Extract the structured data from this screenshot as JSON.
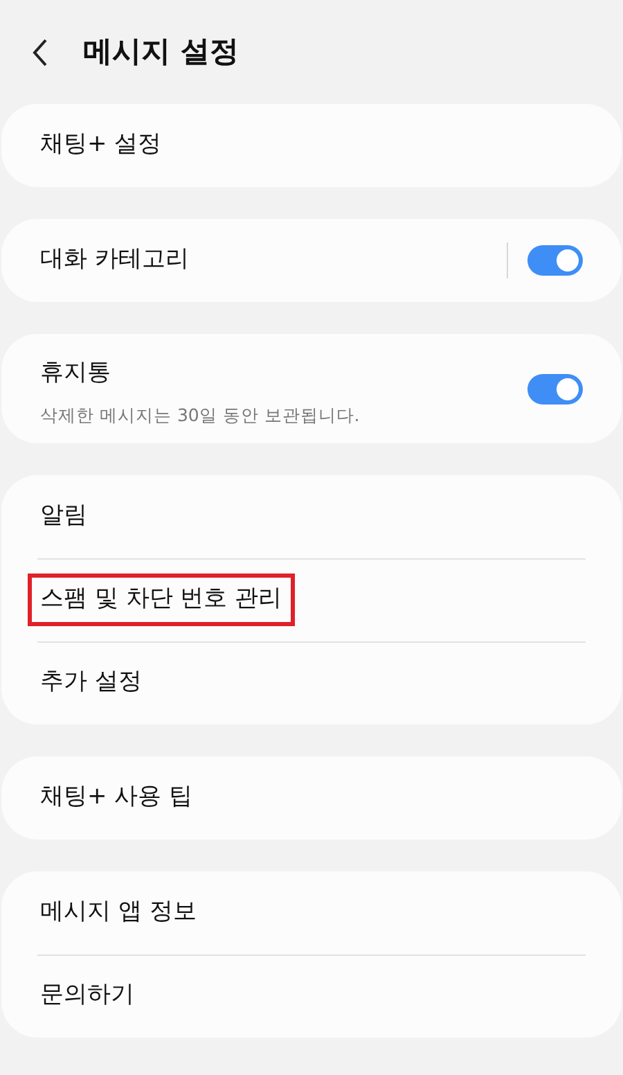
{
  "header": {
    "title": "메시지 설정"
  },
  "groups": [
    {
      "items": [
        {
          "kind": "link",
          "label": "채팅+ 설정",
          "highlighted": false
        }
      ]
    },
    {
      "items": [
        {
          "kind": "split-toggle",
          "label": "대화 카테고리",
          "on": true,
          "highlighted": false
        }
      ]
    },
    {
      "items": [
        {
          "kind": "toggle",
          "label": "휴지통",
          "subtitle": "삭제한 메시지는 30일 동안 보관됩니다.",
          "on": true,
          "highlighted": false
        }
      ]
    },
    {
      "items": [
        {
          "kind": "link",
          "label": "알림",
          "highlighted": false
        },
        {
          "kind": "link",
          "label": "스팸 및 차단 번호 관리",
          "highlighted": true
        },
        {
          "kind": "link",
          "label": "추가 설정",
          "highlighted": false
        }
      ]
    },
    {
      "items": [
        {
          "kind": "link",
          "label": "채팅+ 사용 팁",
          "highlighted": false
        }
      ]
    },
    {
      "items": [
        {
          "kind": "link",
          "label": "메시지 앱 정보",
          "highlighted": false
        },
        {
          "kind": "link",
          "label": "문의하기",
          "highlighted": false
        }
      ]
    }
  ]
}
